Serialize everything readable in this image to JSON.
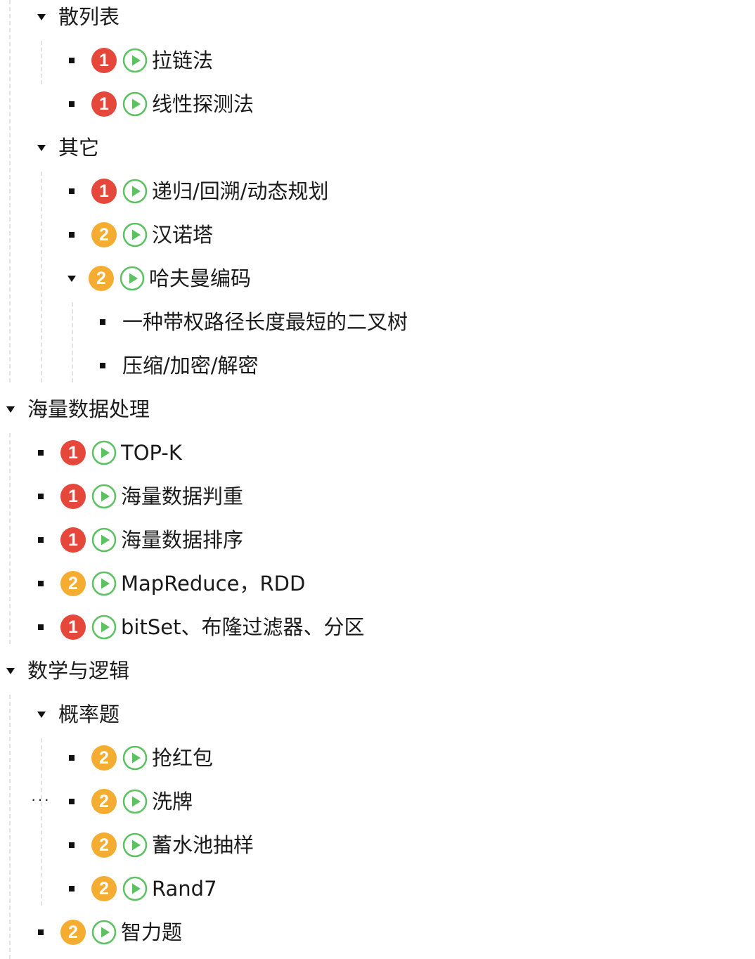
{
  "outline": {
    "hash_table": {
      "label": "散列表",
      "children": [
        {
          "priority": "1",
          "label": "拉链法"
        },
        {
          "priority": "1",
          "label": "线性探测法"
        }
      ]
    },
    "others": {
      "label": "其它",
      "children": [
        {
          "priority": "1",
          "label": "递归/回溯/动态规划"
        },
        {
          "priority": "2",
          "label": "汉诺塔"
        },
        {
          "priority": "2",
          "label": "哈夫曼编码",
          "children": [
            {
              "label": "一种带权路径长度最短的二叉树"
            },
            {
              "label": "压缩/加密/解密"
            }
          ]
        }
      ]
    },
    "big_data": {
      "label": "海量数据处理",
      "children": [
        {
          "priority": "1",
          "label": "TOP-K"
        },
        {
          "priority": "1",
          "label": "海量数据判重"
        },
        {
          "priority": "1",
          "label": "海量数据排序"
        },
        {
          "priority": "2",
          "label": "MapReduce，RDD"
        },
        {
          "priority": "1",
          "label": "bitSet、布隆过滤器、分区"
        }
      ]
    },
    "math_logic": {
      "label": "数学与逻辑",
      "probability": {
        "label": "概率题",
        "children": [
          {
            "priority": "2",
            "label": "抢红包"
          },
          {
            "priority": "2",
            "label": "洗牌"
          },
          {
            "priority": "2",
            "label": "蓄水池抽样"
          },
          {
            "priority": "2",
            "label": "Rand7"
          }
        ]
      },
      "puzzle": {
        "priority": "2",
        "label": "智力题"
      }
    },
    "more_handle": "···"
  },
  "colors": {
    "priority_1": "#e5483b",
    "priority_2": "#f4ad31",
    "play_icon": "#5cc261",
    "guide_line": "#e2e2e2"
  }
}
